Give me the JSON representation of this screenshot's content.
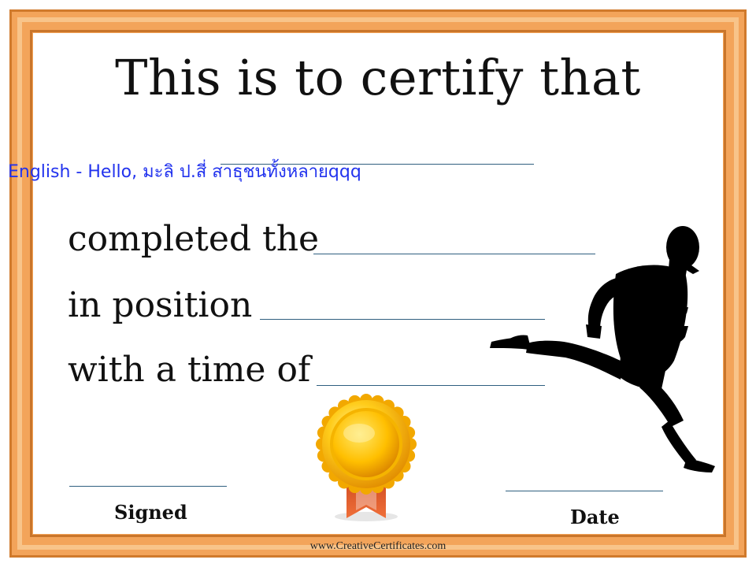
{
  "certificate": {
    "title": "This is to certify that",
    "overlay_text": "English  -  Hello,  มะลิ  ป.สี่  สาธุชนทั้งหลายqqq",
    "rows": [
      {
        "label": "completed the"
      },
      {
        "label": "in position"
      },
      {
        "label": "with a time of"
      }
    ],
    "signed_label": "Signed",
    "date_label": "Date",
    "footer_url": "www.CreativeCertificates.com"
  },
  "colors": {
    "frame": "#f3a45a",
    "frame_dark": "#c9752a",
    "overlay_text": "#2233ee",
    "line": "#2f5f7f",
    "medal_gold": "#f5b400",
    "ribbon": "#e8572a"
  },
  "icons": {
    "runner": "runner-silhouette-icon",
    "medal": "award-medal-icon"
  }
}
